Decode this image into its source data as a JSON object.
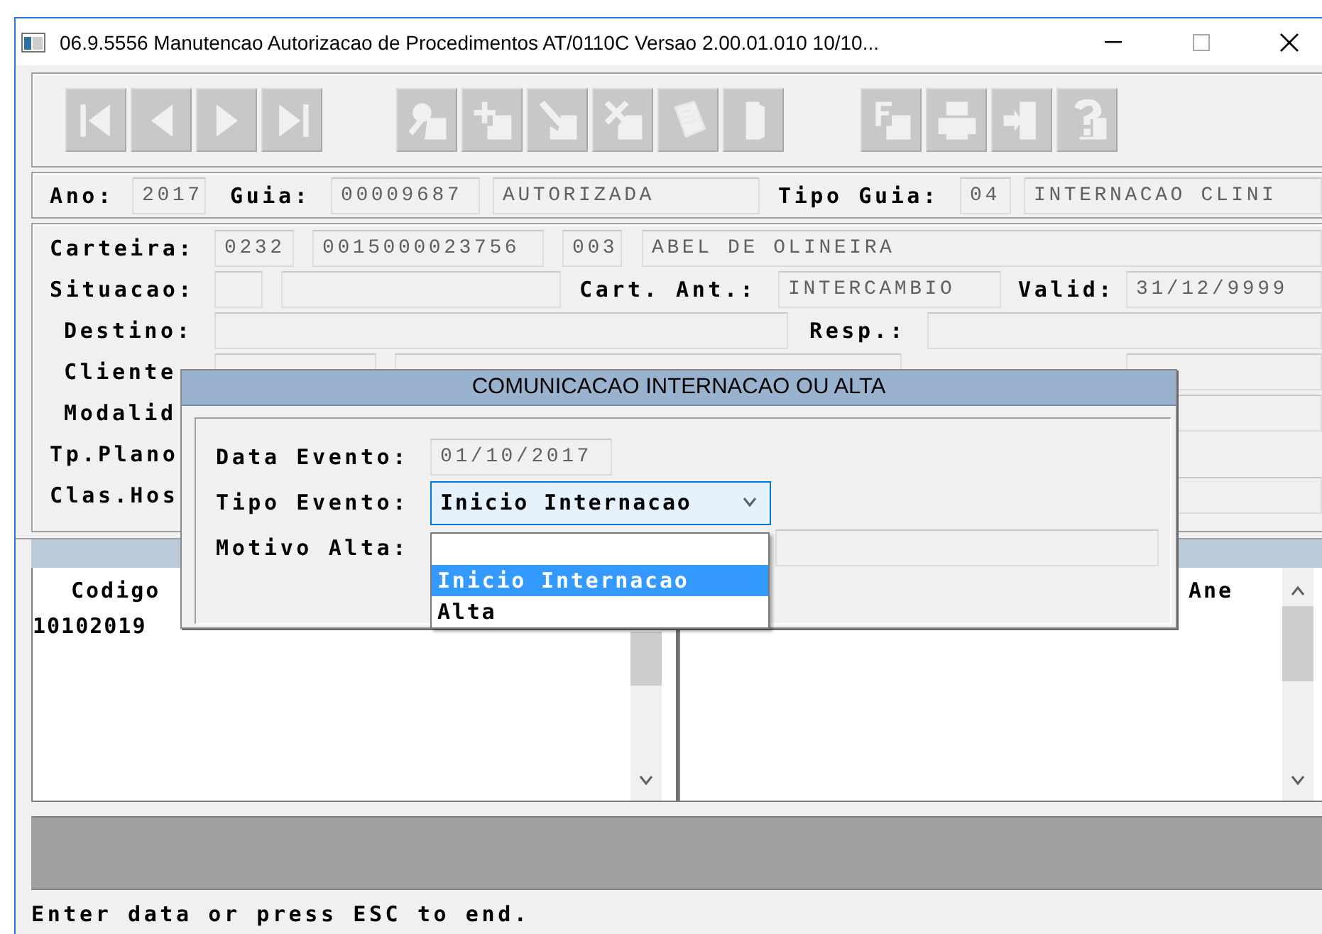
{
  "window": {
    "title": "06.9.5556 Manutencao Autorizacao de Procedimentos AT/0110C Versao 2.00.01.010 10/10..."
  },
  "header": [
    {
      "kind": "label",
      "text": "Ano:"
    },
    {
      "kind": "field",
      "value": "2017"
    },
    {
      "kind": "label",
      "text": "Guia:"
    },
    {
      "kind": "field",
      "value": "00009687"
    },
    {
      "kind": "field",
      "value": "AUTORIZADA"
    },
    {
      "kind": "label",
      "text": "Tipo Guia:"
    },
    {
      "kind": "field",
      "value": "04"
    },
    {
      "kind": "field",
      "value": "INTERNACAO CLINI"
    }
  ],
  "form": {
    "rows": [
      {
        "items": [
          {
            "kind": "label",
            "text": "Carteira:"
          },
          {
            "kind": "field",
            "value": "0232"
          },
          {
            "kind": "field",
            "value": "0015000023756"
          },
          {
            "kind": "field",
            "value": "003"
          },
          {
            "kind": "field",
            "value": "ABEL DE OLINEIRA"
          }
        ]
      },
      {
        "items": [
          {
            "kind": "label",
            "text": "Situacao:"
          },
          {
            "kind": "field"
          },
          {
            "kind": "field"
          },
          {
            "kind": "label",
            "text": "Cart. Ant.:"
          },
          {
            "kind": "field",
            "value": "INTERCAMBIO"
          },
          {
            "kind": "label",
            "text": "Valid:"
          },
          {
            "kind": "field",
            "value": "31/12/9999"
          }
        ]
      },
      {
        "items": [
          {
            "kind": "label",
            "text": "Destino:"
          },
          {
            "kind": "field"
          },
          {
            "kind": "label",
            "text": "Resp.:"
          },
          {
            "kind": "field"
          }
        ]
      },
      {
        "items": [
          {
            "kind": "label",
            "text": "Cliente"
          },
          {
            "kind": "field"
          },
          {
            "kind": "field"
          },
          {
            "kind": "field"
          }
        ]
      },
      {
        "items": [
          {
            "kind": "label",
            "text": "Modalid"
          },
          {
            "kind": "field"
          }
        ]
      },
      {
        "items": [
          {
            "kind": "label",
            "text": "Tp.Plano"
          }
        ]
      },
      {
        "items": [
          {
            "kind": "label",
            "text": "Clas.Hos"
          },
          {
            "kind": "field"
          }
        ]
      }
    ]
  },
  "grid": {
    "left": {
      "columns": [
        "Codigo"
      ],
      "rows": [
        "10102019"
      ]
    },
    "right": {
      "columns": [
        "Ane"
      ]
    }
  },
  "dialog": {
    "title": "COMUNICACAO INTERNACAO OU ALTA",
    "fields": [
      {
        "kind": "text",
        "label": "Data Evento:",
        "value": "01/10/2017"
      },
      {
        "kind": "select",
        "label": "Tipo Evento:",
        "value": "Inicio Internacao",
        "expanded": true,
        "options": [
          {
            "text": "Inicio Internacao",
            "selected": true
          },
          {
            "text": "Alta",
            "selected": false
          }
        ]
      },
      {
        "kind": "text",
        "label": "Motivo Alta:"
      }
    ]
  },
  "status_bar": {
    "text": "Enter data or press ESC to end."
  }
}
